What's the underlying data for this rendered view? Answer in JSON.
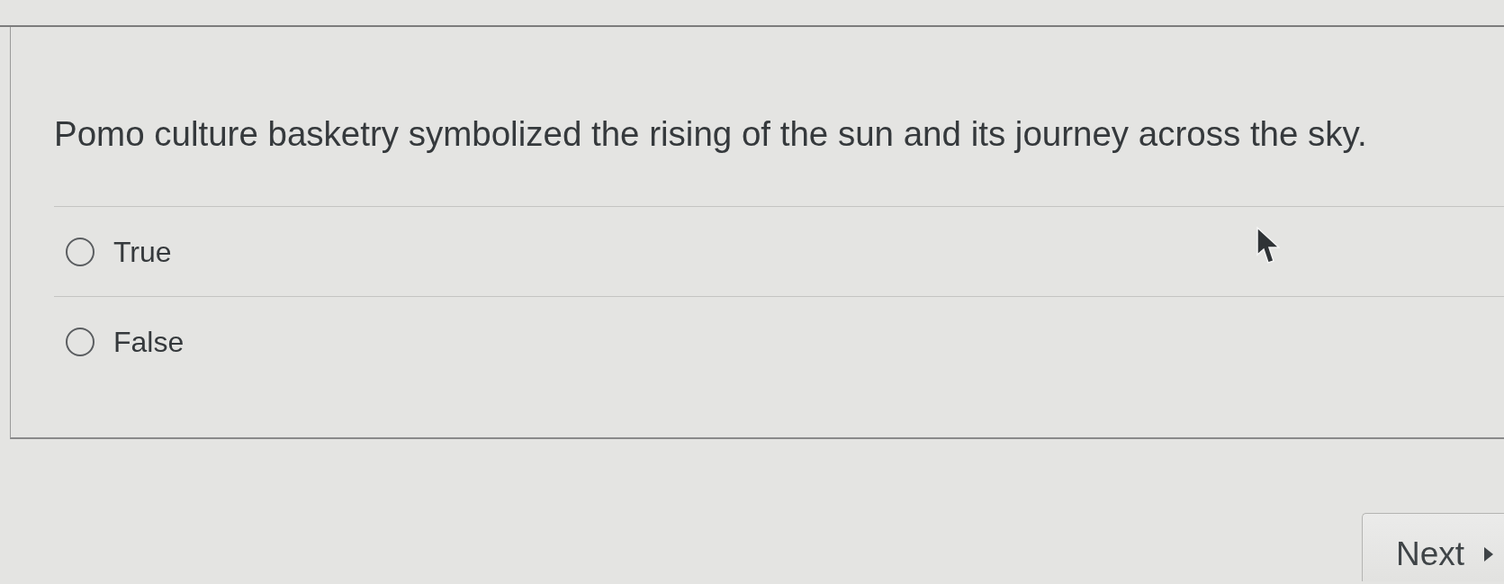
{
  "question": {
    "text": "Pomo culture basketry symbolized the rising of the sun and its journey across the sky."
  },
  "options": [
    {
      "label": "True",
      "selected": false
    },
    {
      "label": "False",
      "selected": false
    }
  ],
  "next_button": {
    "label": "Next"
  }
}
